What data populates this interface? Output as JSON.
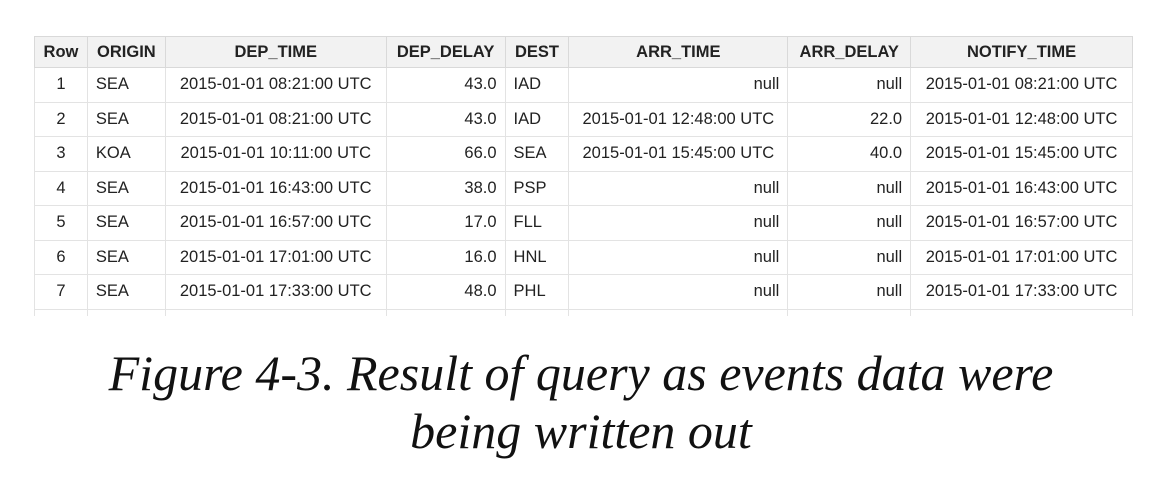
{
  "table": {
    "headers": [
      "Row",
      "ORIGIN",
      "DEP_TIME",
      "DEP_DELAY",
      "DEST",
      "ARR_TIME",
      "ARR_DELAY",
      "NOTIFY_TIME"
    ],
    "rows": [
      [
        "1",
        "SEA",
        "2015-01-01 08:21:00 UTC",
        "43.0",
        "IAD",
        "null",
        "null",
        "2015-01-01 08:21:00 UTC"
      ],
      [
        "2",
        "SEA",
        "2015-01-01 08:21:00 UTC",
        "43.0",
        "IAD",
        "2015-01-01 12:48:00 UTC",
        "22.0",
        "2015-01-01 12:48:00 UTC"
      ],
      [
        "3",
        "KOA",
        "2015-01-01 10:11:00 UTC",
        "66.0",
        "SEA",
        "2015-01-01 15:45:00 UTC",
        "40.0",
        "2015-01-01 15:45:00 UTC"
      ],
      [
        "4",
        "SEA",
        "2015-01-01 16:43:00 UTC",
        "38.0",
        "PSP",
        "null",
        "null",
        "2015-01-01 16:43:00 UTC"
      ],
      [
        "5",
        "SEA",
        "2015-01-01 16:57:00 UTC",
        "17.0",
        "FLL",
        "null",
        "null",
        "2015-01-01 16:57:00 UTC"
      ],
      [
        "6",
        "SEA",
        "2015-01-01 17:01:00 UTC",
        "16.0",
        "HNL",
        "null",
        "null",
        "2015-01-01 17:01:00 UTC"
      ],
      [
        "7",
        "SEA",
        "2015-01-01 17:33:00 UTC",
        "48.0",
        "PHL",
        "null",
        "null",
        "2015-01-01 17:33:00 UTC"
      ]
    ]
  },
  "caption": {
    "line1": "Figure 4-3. Result of query as events data were",
    "line2": "being written out"
  }
}
